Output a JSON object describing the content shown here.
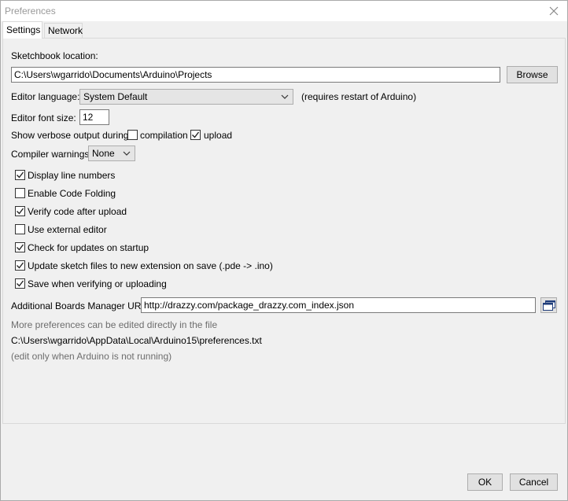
{
  "window": {
    "title": "Preferences"
  },
  "tabs": [
    {
      "label": "Settings",
      "active": true
    },
    {
      "label": "Network",
      "active": false
    }
  ],
  "settings": {
    "sketchbook_label": "Sketchbook location:",
    "sketchbook_path": "C:\\Users\\wgarrido\\Documents\\Arduino\\Projects",
    "browse_label": "Browse",
    "editor_language_label": "Editor language:",
    "editor_language_value": "System Default",
    "editor_language_note": "(requires restart of Arduino)",
    "font_size_label": "Editor font size:",
    "font_size_value": "12",
    "verbose_label": "Show verbose output during:",
    "verbose_compilation_label": "compilation",
    "verbose_compilation_checked": false,
    "verbose_upload_label": "upload",
    "verbose_upload_checked": true,
    "compiler_warnings_label": "Compiler warnings:",
    "compiler_warnings_value": "None",
    "options": [
      {
        "label": "Display line numbers",
        "checked": true
      },
      {
        "label": "Enable Code Folding",
        "checked": false
      },
      {
        "label": "Verify code after upload",
        "checked": true
      },
      {
        "label": "Use external editor",
        "checked": false
      },
      {
        "label": "Check for updates on startup",
        "checked": true
      },
      {
        "label": "Update sketch files to new extension on save (.pde -> .ino)",
        "checked": true
      },
      {
        "label": "Save when verifying or uploading",
        "checked": true
      }
    ],
    "boards_url_label": "Additional Boards Manager URLs:",
    "boards_url_value": "http://drazzy.com/package_drazzy.com_index.json",
    "more_prefs_text": "More preferences can be edited directly in the file",
    "prefs_path": "C:\\Users\\wgarrido\\AppData\\Local\\Arduino15\\preferences.txt",
    "edit_note": "(edit only when Arduino is not running)"
  },
  "footer": {
    "ok_label": "OK",
    "cancel_label": "Cancel"
  },
  "icons": {
    "close": "close-icon",
    "dropdown": "chevron-down-icon",
    "window": "window-icon"
  }
}
